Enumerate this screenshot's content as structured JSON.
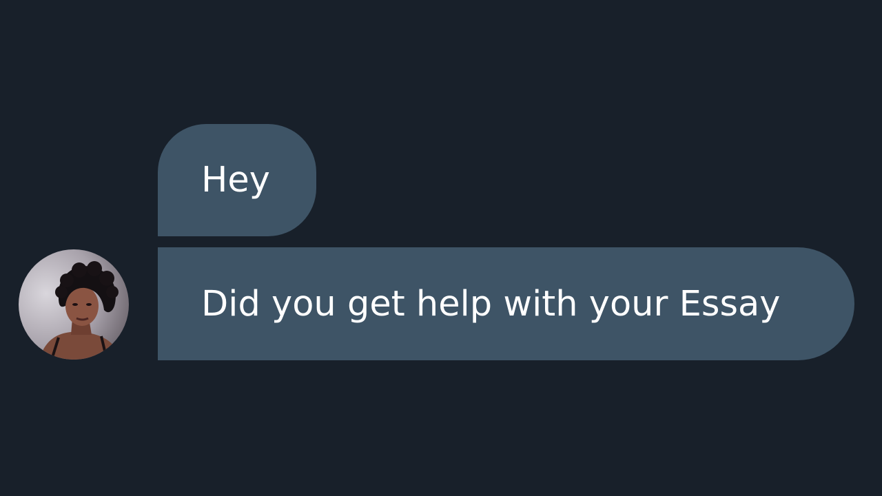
{
  "conversation": {
    "messages": [
      {
        "text": "Hey"
      },
      {
        "text": "Did you get help with your Essay"
      }
    ],
    "avatar_icon": "profile-photo",
    "colors": {
      "background": "#18202a",
      "bubble": "#3e5466",
      "text": "#ffffff"
    }
  }
}
